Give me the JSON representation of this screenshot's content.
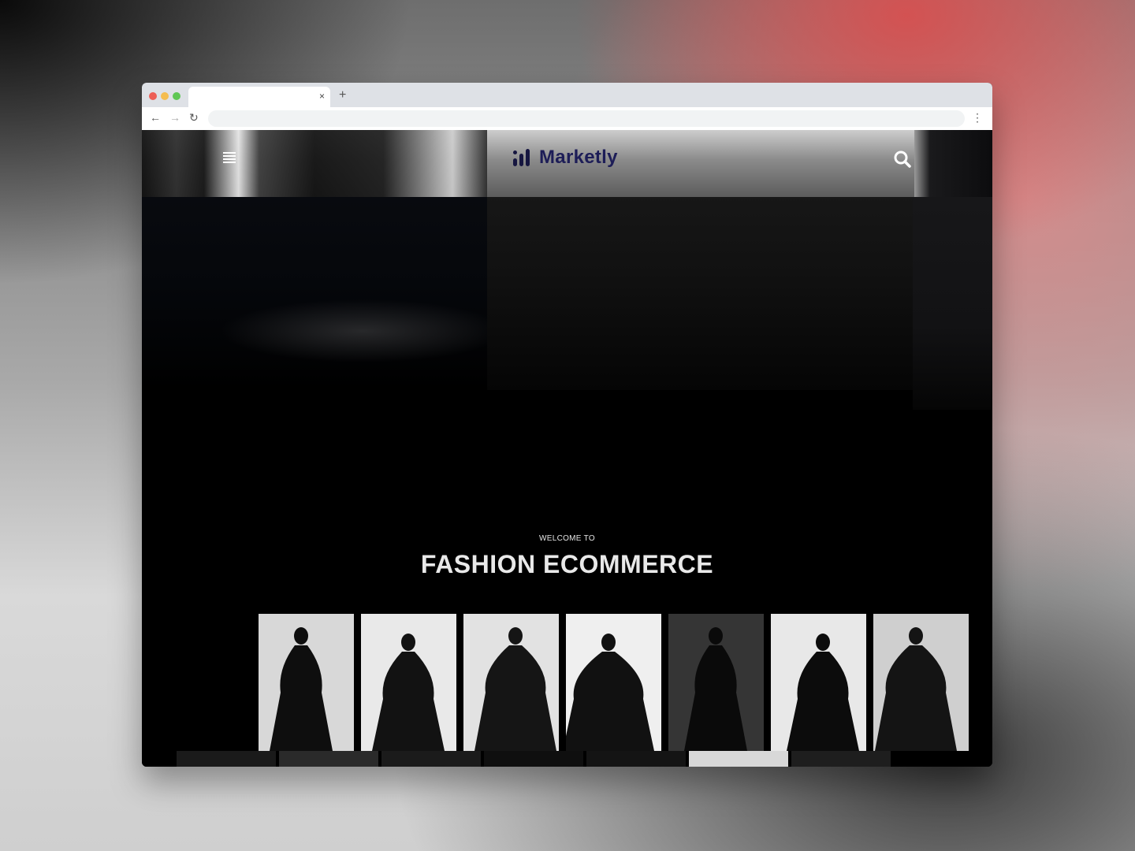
{
  "browser": {
    "tab_title": "",
    "tab_close": "×",
    "new_tab": "+",
    "back": "←",
    "forward": "→",
    "reload": "↻",
    "address": "",
    "menu": "⋮",
    "traffic_lights": [
      "#ed5f57",
      "#f5bd4f",
      "#5fc754"
    ]
  },
  "site": {
    "brand": "Marketly",
    "brand_color": "#1d1d57",
    "menu_icon": "hamburger-icon",
    "search_icon": "search-icon"
  },
  "hero": {
    "eyebrow": "WELCOME TO",
    "title": "FASHION ECOMMERCE"
  },
  "gallery": {
    "cards": [
      {
        "bg": "#d8d8d8",
        "figure": "#0e0e0e"
      },
      {
        "bg": "#e9e9e9",
        "figure": "#121212"
      },
      {
        "bg": "#e2e2e2",
        "figure": "#151515"
      },
      {
        "bg": "#efefef",
        "figure": "#111111"
      },
      {
        "bg": "#353535",
        "figure": "#0a0a0a"
      },
      {
        "bg": "#e8e8e8",
        "figure": "#0c0c0c"
      },
      {
        "bg": "#cfcfcf",
        "figure": "#141414"
      }
    ],
    "row2": [
      {
        "bg": "#1a1a1a"
      },
      {
        "bg": "#2a2a2a"
      },
      {
        "bg": "#1b1b1b"
      },
      {
        "bg": "#0f0f0f"
      },
      {
        "bg": "#141414"
      },
      {
        "bg": "#d8d8d8"
      },
      {
        "bg": "#1e1e1e"
      }
    ]
  }
}
